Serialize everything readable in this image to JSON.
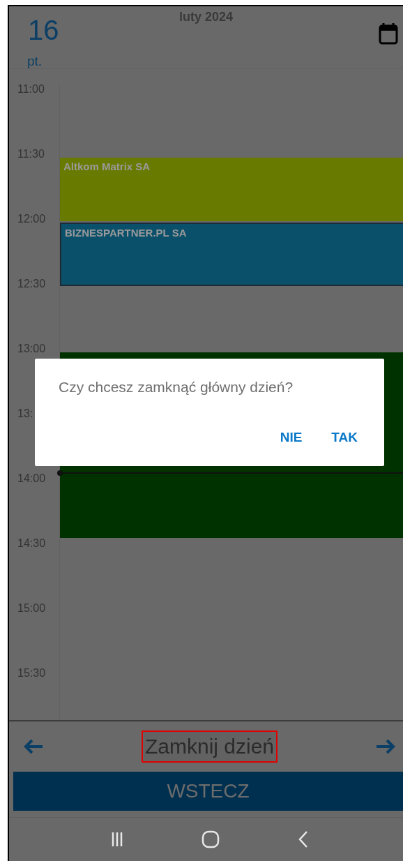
{
  "header": {
    "day": "16",
    "weekday": "pt.",
    "month": "luty 2024"
  },
  "slots": [
    {
      "time": "11:00"
    },
    {
      "time": "11:30",
      "events": [
        {
          "title": "Altkom Matrix SA",
          "color": "#697a00",
          "selected": false
        }
      ]
    },
    {
      "time": "12:00",
      "events": [
        {
          "title": "BIZNESPARTNER.PL SA",
          "color": "#0b506a",
          "selected": true
        }
      ]
    },
    {
      "time": "12:30"
    },
    {
      "time": "13:00",
      "events": [
        {
          "color": "#003200",
          "selected": false
        }
      ]
    },
    {
      "time": "13:",
      "events": [
        {
          "continued": true
        }
      ]
    },
    {
      "time": "14:00",
      "current_time": true,
      "events": [
        {
          "continued": true
        }
      ]
    },
    {
      "time": "14:30"
    },
    {
      "time": "15:00"
    },
    {
      "time": "15:30"
    }
  ],
  "dialog": {
    "message": "Czy chcesz zamknąć główny dzień?",
    "buttons": [
      "NIE",
      "TAK"
    ]
  },
  "footer": {
    "title": "Zamknij dzień",
    "highlighted": true,
    "back_button": "WSTECZ"
  }
}
